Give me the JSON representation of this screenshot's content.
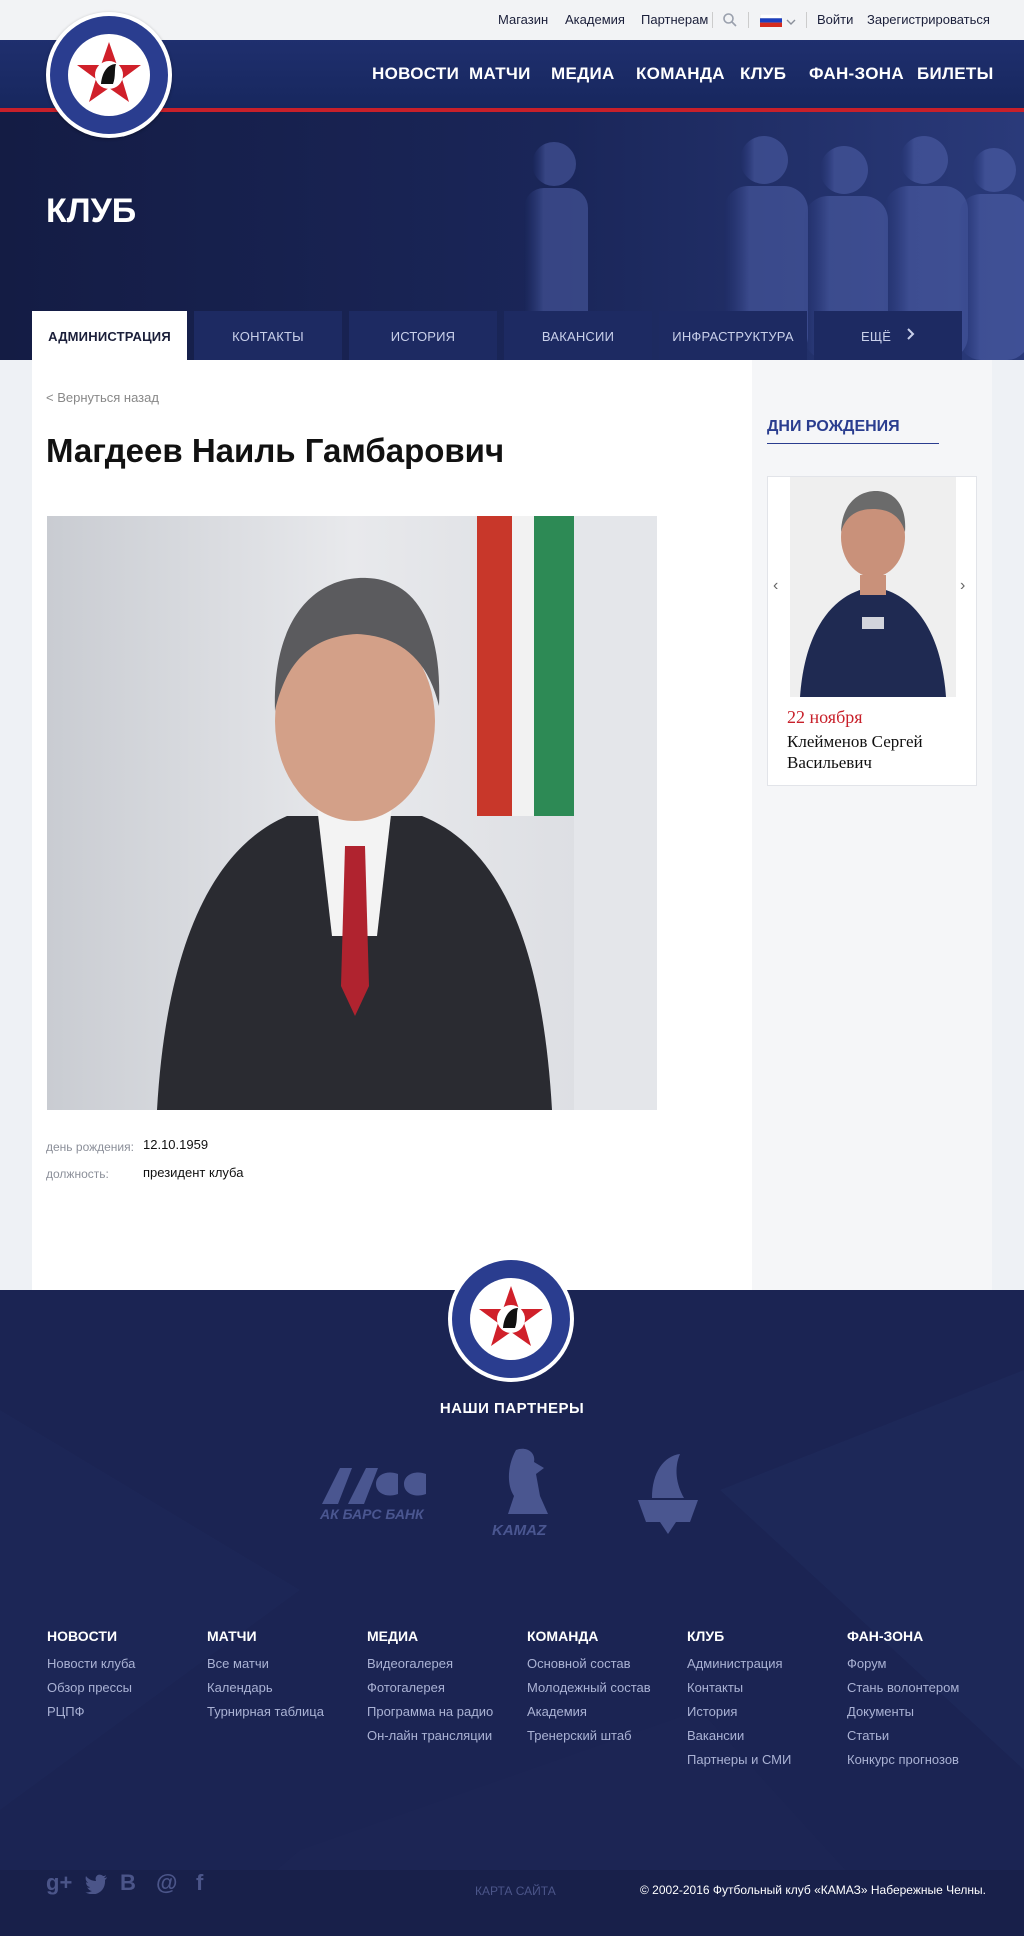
{
  "topbar": {
    "links": [
      "Магазин",
      "Академия",
      "Партнерам"
    ],
    "login": "Войти",
    "register": "Зарегистрироваться"
  },
  "nav": [
    "НОВОСТИ",
    "МАТЧИ",
    "МЕДИА",
    "КОМАНДА",
    "КЛУБ",
    "ФАН-ЗОНА",
    "БИЛЕТЫ"
  ],
  "hero": {
    "title": "КЛУБ"
  },
  "tabs": [
    "АДМИНИСТРАЦИЯ",
    "КОНТАКТЫ",
    "ИСТОРИЯ",
    "ВАКАНСИИ",
    "ИНФРАСТРУКТУРА",
    "ЕЩЁ"
  ],
  "page": {
    "back": "< Вернуться назад",
    "name": "Магдеев Наиль Гамбарович",
    "birthday_label": "день рождения:",
    "birthday_value": "12.10.1959",
    "position_label": "должность:",
    "position_value": "президент клуба"
  },
  "birthdays": {
    "title": "ДНИ РОЖДЕНИЯ",
    "date": "22 ноября",
    "name": "Клейменов Сергей Васильевич"
  },
  "footer": {
    "partners_title": "НАШИ ПАРТНЕРЫ",
    "partners": [
      "АК БАРС БАНК",
      "KAMAZ"
    ],
    "columns": [
      {
        "title": "НОВОСТИ",
        "items": [
          "Новости клуба",
          "Обзор прессы",
          "РЦПФ"
        ]
      },
      {
        "title": "МАТЧИ",
        "items": [
          "Все матчи",
          "Календарь",
          "Турнирная таблица"
        ]
      },
      {
        "title": "МЕДИА",
        "items": [
          "Видеогалерея",
          "Фотогалерея",
          "Программа на радио",
          "Он-лайн трансляции"
        ]
      },
      {
        "title": "КОМАНДА",
        "items": [
          "Основной состав",
          "Молодежный состав",
          "Академия",
          "Тренерский штаб"
        ]
      },
      {
        "title": "КЛУБ",
        "items": [
          "Администрация",
          "Контакты",
          "История",
          "Вакансии",
          "Партнеры и СМИ"
        ]
      },
      {
        "title": "ФАН-ЗОНА",
        "items": [
          "Форум",
          "Стань волонтером",
          "Документы",
          "Статьи",
          "Конкурс прогнозов"
        ]
      }
    ],
    "sitemap": "КАРТА САЙТА",
    "copyright": "© 2002-2016 Футбольный клуб «КАМАЗ» Набережные Челны."
  },
  "colors": {
    "navy": "#1d2a62",
    "accent_red": "#c8202a",
    "brand_blue": "#2a3d8f"
  },
  "icons": [
    "search-icon",
    "russia-flag-icon",
    "chevron-down-icon",
    "chevron-right-icon",
    "chevron-left-icon",
    "google-plus-icon",
    "twitter-icon",
    "vk-icon",
    "mail-icon",
    "facebook-icon"
  ]
}
